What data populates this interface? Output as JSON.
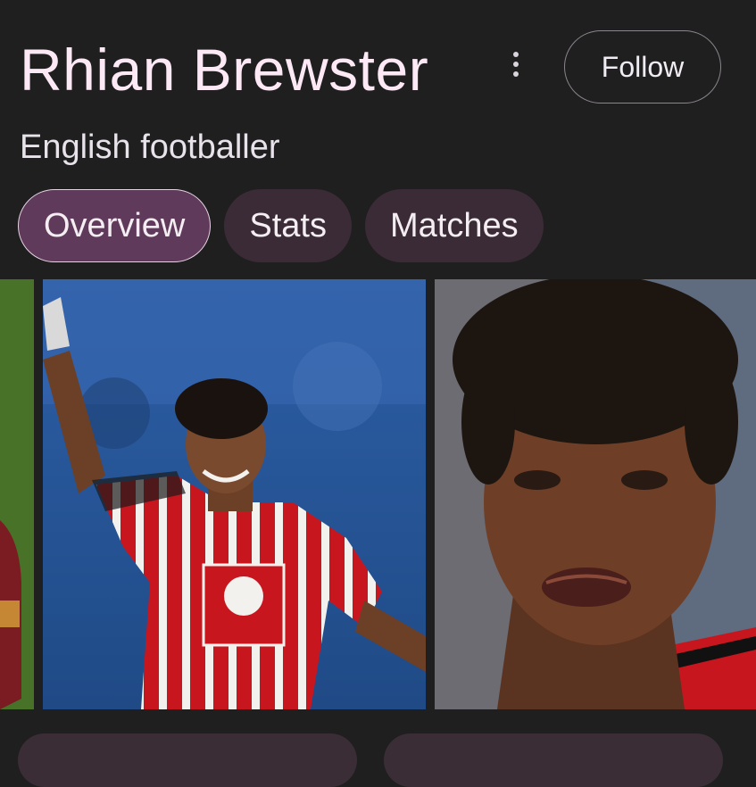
{
  "header": {
    "title": "Rhian Brewster",
    "subtitle": "English footballer",
    "follow_label": "Follow"
  },
  "tabs": [
    {
      "label": "Overview",
      "active": true
    },
    {
      "label": "Stats",
      "active": false
    },
    {
      "label": "Matches",
      "active": false
    }
  ],
  "icons": {
    "more": "more-vert-icon"
  },
  "colors": {
    "background": "#1f1f1f",
    "title": "#fde9f6",
    "active_tab": "#603a5a",
    "tab": "#3b2b36"
  }
}
